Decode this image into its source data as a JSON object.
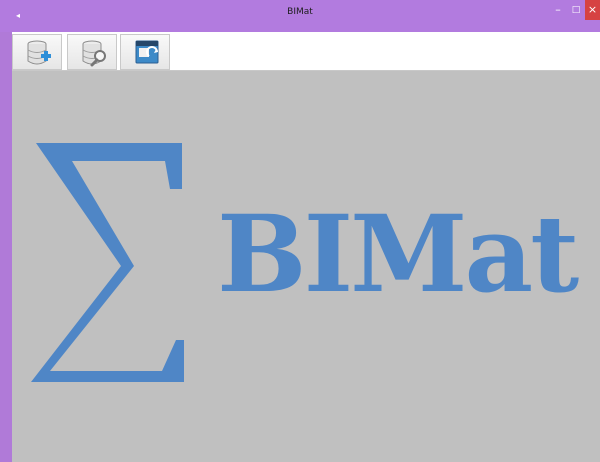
{
  "window": {
    "title": "BIMat",
    "controls": {
      "minimize": "–",
      "maximize": "□",
      "close": "×"
    }
  },
  "toolbar": {
    "buttons": [
      {
        "name": "add-database",
        "icon": "database-plus-icon"
      },
      {
        "name": "search-database",
        "icon": "database-search-icon"
      },
      {
        "name": "window-refresh",
        "icon": "window-refresh-icon"
      }
    ]
  },
  "main": {
    "logo_symbol": "∑",
    "logo_text": "BIMat"
  },
  "colors": {
    "titlebar": "#b27bdf",
    "close": "#d64242",
    "accent": "#4f86c6",
    "background": "#c0c0c0"
  }
}
